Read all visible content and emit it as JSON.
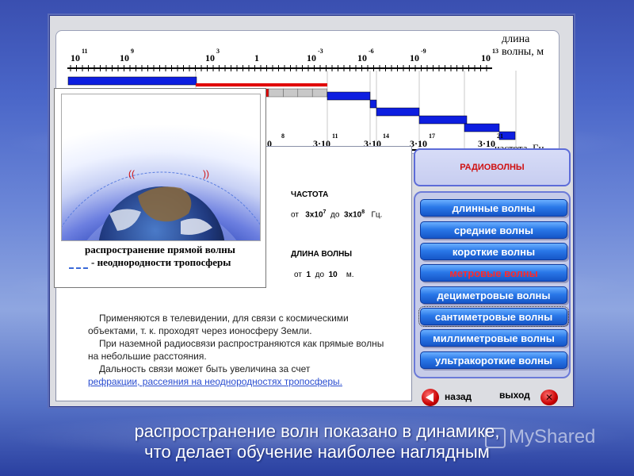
{
  "scale": {
    "wavelength_ticks": [
      {
        "base": "10",
        "exp": "11"
      },
      {
        "base": "10",
        "exp": "9"
      },
      {
        "base": "10",
        "exp": "3"
      },
      {
        "base": "1",
        "exp": ""
      },
      {
        "base": "10",
        "exp": "-3"
      },
      {
        "base": "10",
        "exp": "-6"
      },
      {
        "base": "10",
        "exp": "-9"
      },
      {
        "base": "10",
        "exp": "13"
      }
    ],
    "wavelength_label_line1": "длина",
    "wavelength_label_line2": "волны, м",
    "frequency_ticks": [
      {
        "base": "10",
        "exp": "8"
      },
      {
        "base": "3·10",
        "exp": "11"
      },
      {
        "base": "3·10",
        "exp": "14"
      },
      {
        "base": "3·10",
        "exp": "17"
      },
      {
        "base": "3·10",
        "exp": "21"
      }
    ],
    "frequency_label": "частота, Гц",
    "bar_colors": {
      "blue": "#0d1ee0",
      "red": "#e00000",
      "grey": "#c8c8c8"
    }
  },
  "content": {
    "frequency_heading": "ЧАСТОТА",
    "frequency_from_word": "от",
    "frequency_from_base": "3х10",
    "frequency_from_exp": "7",
    "frequency_to_word": "до",
    "frequency_to_base": "3х10",
    "frequency_to_exp": "8",
    "frequency_unit": "Гц.",
    "wavelength_heading": "ДЛИНА ВОЛНЫ",
    "wavelength_from_word": "от",
    "wavelength_from_value": "1",
    "wavelength_to_word": "до",
    "wavelength_to_value": "10",
    "wavelength_unit": "м.",
    "desc_line1": "Применяются в телевидении, для связи с космическими объектами, т. к. проходят через ионосферу Земли.",
    "desc_line2": "При наземной радиосвязи распространяются как прямые волны на небольшие расстояния.",
    "desc_line3": "Дальность связи может быть увеличина за счет",
    "desc_link": "рефракции, рассеяния на неоднородностях тропосферы."
  },
  "inset": {
    "caption1": "распространение прямой волны",
    "caption2": "- неоднородности тропосферы"
  },
  "radio_title": "РАДИОВОЛНЫ",
  "wave_buttons": [
    {
      "label": "длинные волны",
      "active": false
    },
    {
      "label": "средние волны",
      "active": false
    },
    {
      "label": "короткие волны",
      "active": false
    },
    {
      "label": "метровые волны",
      "active": true
    },
    {
      "label": "дециметровые волны",
      "active": false
    },
    {
      "label": "сантиметровые волны",
      "active": false
    },
    {
      "label": "миллиметровые волны",
      "active": false
    },
    {
      "label": "ультракороткие волны",
      "active": false
    }
  ],
  "nav": {
    "back_label": "назад",
    "exit_label": "выход",
    "exit_symbol": "✕"
  },
  "caption_line1": "распространение волн показано в динамике,",
  "caption_line2": "что делает обучение наиболее наглядным",
  "watermark": "MyShared"
}
